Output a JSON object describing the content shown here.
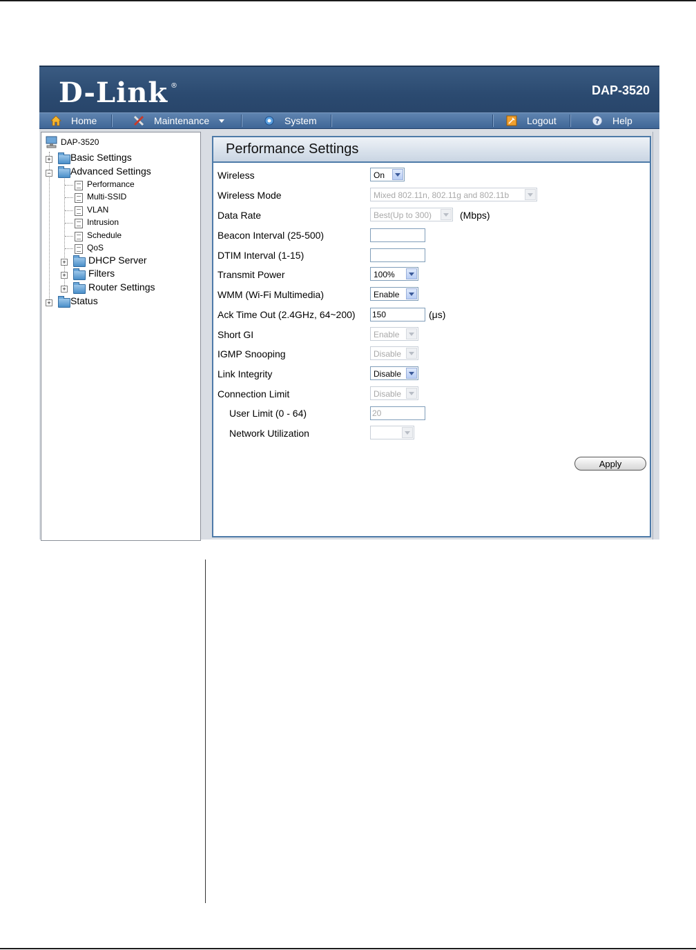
{
  "header": {
    "logo": "D-Link",
    "logo_mark": "®",
    "model": "DAP-3520"
  },
  "menu": {
    "home": "Home",
    "maintenance": "Maintenance",
    "system": "System",
    "logout": "Logout",
    "help": "Help"
  },
  "tree": {
    "root": "DAP-3520",
    "basic": "Basic Settings",
    "advanced": "Advanced Settings",
    "performance": "Performance",
    "multi_ssid": "Multi-SSID",
    "vlan": "VLAN",
    "intrusion": "Intrusion",
    "schedule": "Schedule",
    "qos": "QoS",
    "dhcp": "DHCP Server",
    "filters": "Filters",
    "router": "Router Settings",
    "status": "Status"
  },
  "panel": {
    "title": "Performance Settings",
    "rows": [
      {
        "label": "Wireless",
        "value": "On"
      },
      {
        "label": "Wireless Mode",
        "value": "Mixed 802.11n, 802.11g and 802.11b"
      },
      {
        "label": "Data Rate",
        "value": "Best(Up to 300)",
        "unit": "(Mbps)"
      },
      {
        "label": "Beacon Interval (25-500)",
        "value": ""
      },
      {
        "label": "DTIM Interval (1-15)",
        "value": ""
      },
      {
        "label": "Transmit Power",
        "value": "100%"
      },
      {
        "label": "WMM (Wi-Fi Multimedia)",
        "value": "Enable"
      },
      {
        "label": "Ack Time Out (2.4GHz, 64~200)",
        "value": "150",
        "unit": "(μs)"
      },
      {
        "label": "Short GI",
        "value": "Enable"
      },
      {
        "label": "IGMP Snooping",
        "value": "Disable"
      },
      {
        "label": "Link Integrity",
        "value": "Disable"
      },
      {
        "label": "Connection Limit",
        "value": "Disable"
      },
      {
        "label": "User Limit (0 - 64)",
        "value": "20"
      },
      {
        "label": "Network Utilization",
        "value": ""
      }
    ],
    "apply": "Apply"
  }
}
